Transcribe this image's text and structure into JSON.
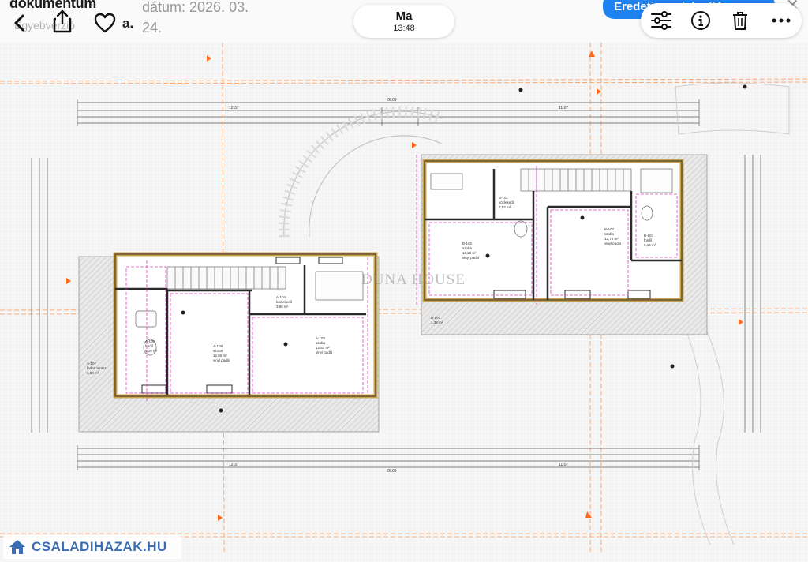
{
  "header": {
    "document_title": "dokumentum",
    "document_subtitle": "Egyebverzió",
    "date_text": "dátum: 2026. 03.",
    "date_line2": "24.",
    "owner_initial": "a.",
    "day_label": "Ma",
    "time_label": "13:48",
    "original_view_label": "Eredeti megjelenítése",
    "close_label": "✕"
  },
  "toolbar": {
    "icons": [
      "sliders-icon",
      "info-icon",
      "trash-icon",
      "more-icon"
    ]
  },
  "watermarks": {
    "center_text": "DUNA HOUSE",
    "site_text": "CSALADIHAZAK.HU"
  },
  "plan": {
    "overall_width": "26.09",
    "left_block_width": "12.37",
    "right_block_width": "11.07",
    "left_rooms": [
      {
        "code": "A-106",
        "name": "fürdő",
        "area": "5,14 m²",
        "floor": "vinyl padló"
      },
      {
        "code": "A-108",
        "name": "szoba",
        "area": "12,60 m²",
        "floor": "vinyl padló"
      },
      {
        "code": "A-105",
        "name": "szoba",
        "area": "12,53 m²",
        "floor": "vinyl padló"
      },
      {
        "code": "A-104",
        "name": "közlekedő",
        "area": "3,86 m²",
        "floor": "vinyl padló"
      },
      {
        "code": "A-107",
        "name": "fedett terasz",
        "area": "6,90 m²",
        "floor": ""
      }
    ],
    "right_rooms": [
      {
        "code": "B-102",
        "name": "szoba",
        "area": "13,22 m²",
        "floor": "vinyl padló"
      },
      {
        "code": "B-103",
        "name": "szoba",
        "area": "12,76 m²",
        "floor": "vinyl padló"
      },
      {
        "code": "B-104",
        "name": "fürdő",
        "area": "5,14 m²",
        "floor": "vinyl padló"
      },
      {
        "code": "B-101",
        "name": "közlekedő",
        "area": "3,52 m²",
        "floor": "vinyl padló"
      },
      {
        "code": "B-107",
        "name": "fedett terasz",
        "area": "1,38 m²",
        "floor": ""
      }
    ],
    "colors": {
      "wall": "#c9a24a",
      "wall_dark": "#2a2a2a",
      "axis": "#ff8a3d",
      "annotation": "#e040c8",
      "dimension": "#5a5a5a",
      "accent": "#1e82f0"
    }
  }
}
